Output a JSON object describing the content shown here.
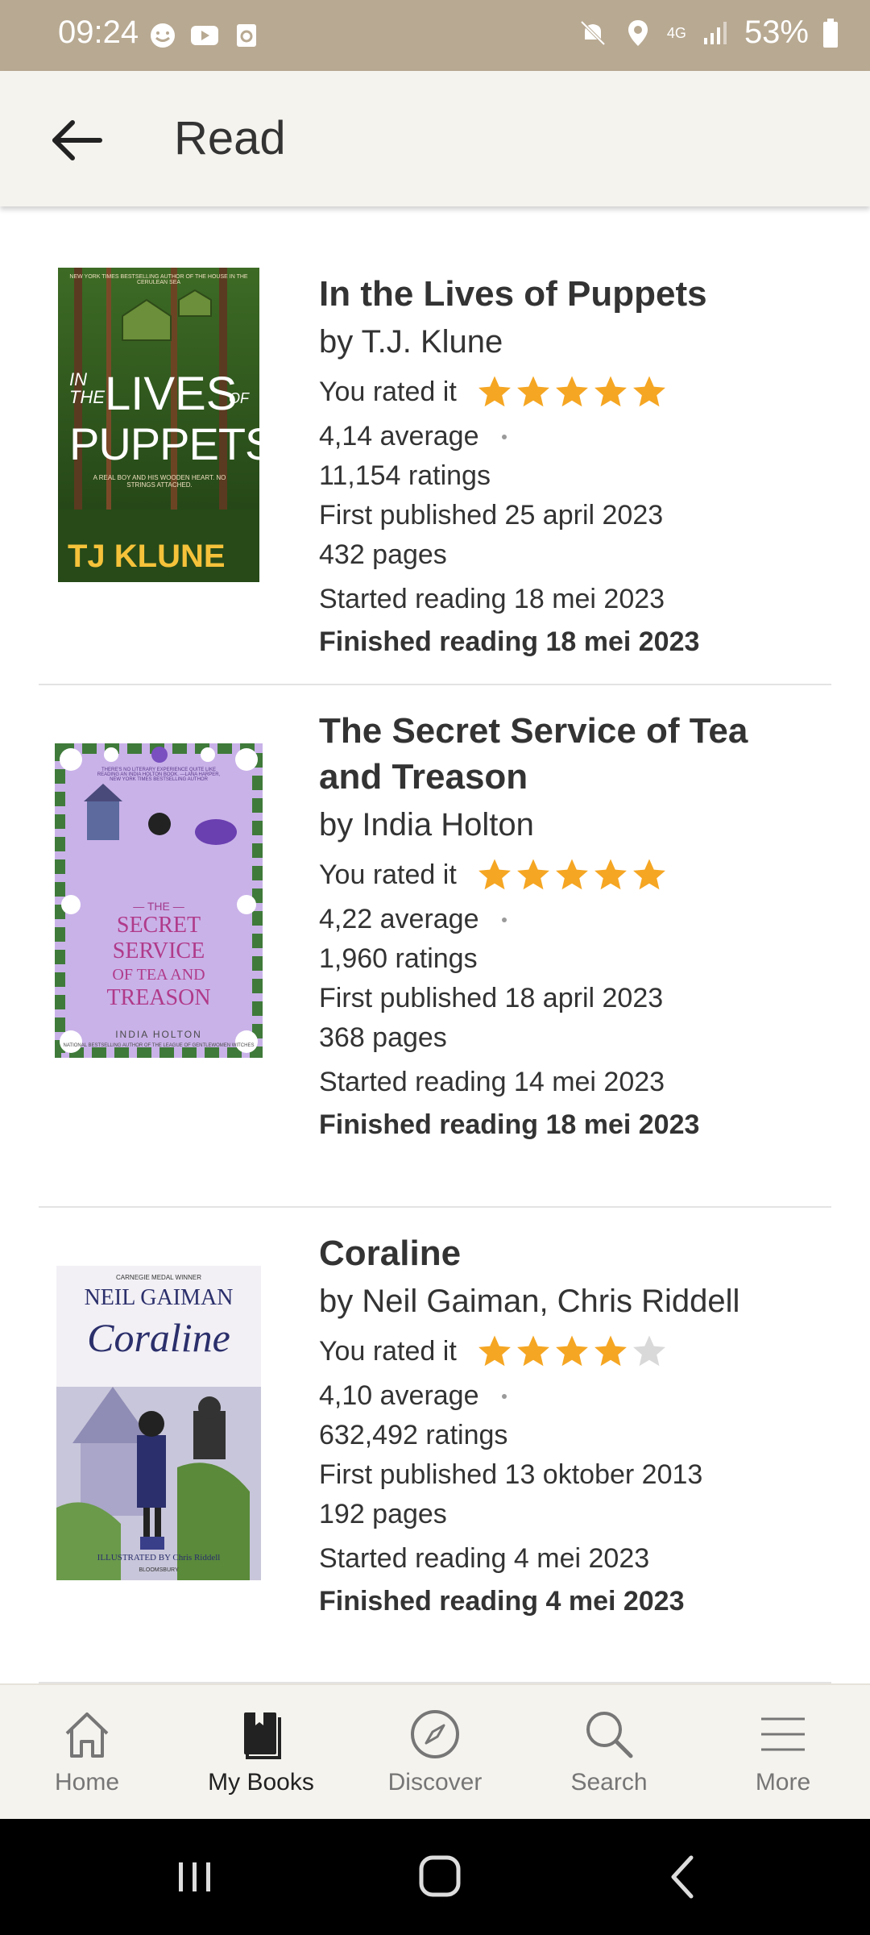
{
  "status_bar": {
    "time": "09:24",
    "battery": "53%",
    "network": "4G"
  },
  "app_bar": {
    "title": "Read"
  },
  "rated_label": "You rated it",
  "books": [
    {
      "title": "In the Lives of Puppets",
      "author": "by T.J. Klune",
      "rating": 5,
      "average": "4,14 average",
      "ratings": "11,154 ratings",
      "first_published": "First published 25 april 2023",
      "pages": "432 pages",
      "started": "Started reading 18 mei 2023",
      "finished": "Finished reading 18 mei 2023",
      "cover": {
        "top_text": "NEW YORK TIMES BESTSELLING AUTHOR OF THE HOUSE IN THE CERULEAN SEA",
        "title_line1_small": "IN THE",
        "title_line1": "LIVES",
        "title_of": "OF",
        "title_line2": "PUPPETS",
        "tagline": "A REAL BOY AND HIS WOODEN HEART. NO STRINGS ATTACHED.",
        "author": "TJ KLUNE"
      }
    },
    {
      "title": "The Secret Service of Tea and Treason",
      "author": "by India Holton",
      "rating": 5,
      "average": "4,22 average",
      "ratings": "1,960 ratings",
      "first_published": "First published 18 april 2023",
      "pages": "368 pages",
      "started": "Started reading 14 mei 2023",
      "finished": "Finished reading 18 mei 2023",
      "cover": {
        "quote": "THERE'S NO LITERARY EXPERIENCE QUITE LIKE READING AN INDIA HOLTON BOOK. —LANA HARPER, NEW YORK TIMES BESTSELLING AUTHOR",
        "the": "— THE —",
        "line1": "SECRET",
        "line2": "SERVICE",
        "line3": "OF TEA AND",
        "line4": "TREASON",
        "author": "INDIA HOLTON",
        "bottom": "NATIONAL BESTSELLING AUTHOR OF THE LEAGUE OF GENTLEWOMEN WITCHES"
      }
    },
    {
      "title": "Coraline",
      "author": "by Neil Gaiman, Chris Riddell",
      "rating": 4,
      "average": "4,10 average",
      "ratings": "632,492 ratings",
      "first_published": "First published 13 oktober 2013",
      "pages": "192 pages",
      "started": "Started reading 4 mei 2023",
      "finished": "Finished reading 4 mei 2023",
      "cover": {
        "medal": "CARNEGIE MEDAL WINNER",
        "author": "NEIL GAIMAN",
        "title": "Coraline",
        "illustrator": "ILLUSTRATED BY Chris Riddell",
        "publisher": "BLOOMSBURY"
      }
    }
  ],
  "bottom_nav": [
    {
      "label": "Home",
      "icon": "home-icon"
    },
    {
      "label": "My Books",
      "icon": "book-icon",
      "active": true
    },
    {
      "label": "Discover",
      "icon": "compass-icon"
    },
    {
      "label": "Search",
      "icon": "search-icon"
    },
    {
      "label": "More",
      "icon": "menu-icon"
    }
  ],
  "colors": {
    "star": "#f5a623",
    "star_empty": "#d9d9d9",
    "status_bar": "#b8a992",
    "app_bar": "#f5f3ee"
  }
}
